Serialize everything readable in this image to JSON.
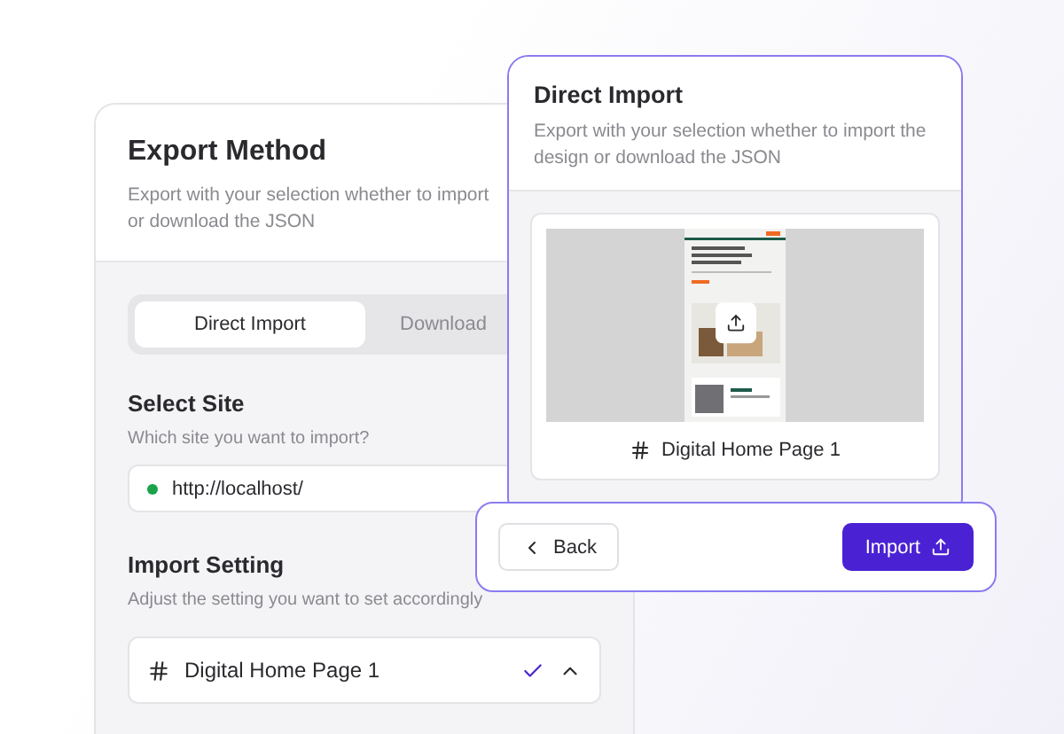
{
  "export_card": {
    "title": "Export Method",
    "description": "Export with your selection whether to import or download the JSON",
    "tabs": [
      {
        "label": "Direct Import",
        "selected": true
      },
      {
        "label": "Download",
        "selected": false
      }
    ],
    "select_site": {
      "title": "Select Site",
      "hint": "Which site you want to import?",
      "url": "http://localhost/"
    },
    "import_setting": {
      "title": "Import Setting",
      "hint": "Adjust the setting you want to set accordingly",
      "page": {
        "label": "Digital Home Page 1",
        "checked": true,
        "expanded": true
      }
    }
  },
  "import_dialog": {
    "title": "Direct Import",
    "description": "Export with your selection whether to import the design or download the JSON",
    "preview": {
      "caption": "Digital Home Page 1"
    }
  },
  "footer": {
    "buttons": [
      {
        "label": "Back",
        "kind": "back"
      },
      {
        "label": "Import",
        "kind": "primary"
      }
    ]
  }
}
